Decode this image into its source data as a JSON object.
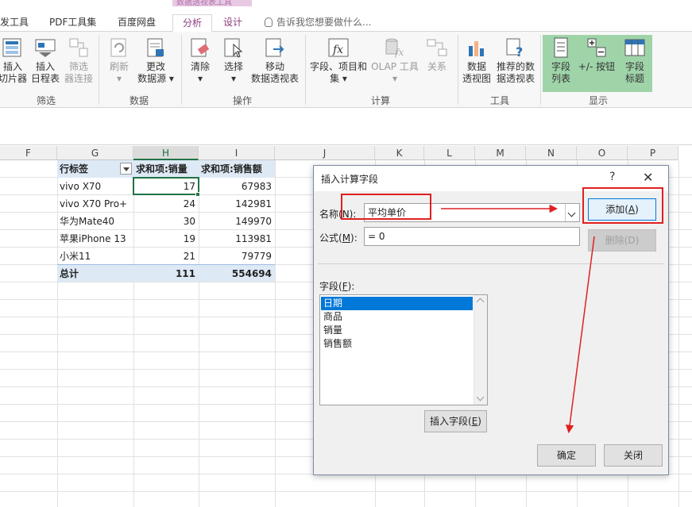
{
  "ribbon": {
    "context_tab_group": "数据透视表工具",
    "tabs": [
      {
        "label": "发工具"
      },
      {
        "label": "PDF工具集"
      },
      {
        "label": "百度网盘"
      },
      {
        "label": "分析"
      },
      {
        "label": "设计"
      }
    ],
    "tell_me": "告诉我您想要做什么...",
    "groups": [
      {
        "label": "筛选",
        "buttons": [
          {
            "l1": "插入",
            "l2": "切片器"
          },
          {
            "l1": "插入",
            "l2": "日程表"
          },
          {
            "l1": "筛选",
            "l2": "器连接"
          }
        ]
      },
      {
        "label": "数据",
        "buttons": [
          {
            "l1": "刷新",
            "l2": ""
          },
          {
            "l1": "更改",
            "l2": "数据源"
          }
        ]
      },
      {
        "label": "操作",
        "buttons": [
          {
            "l1": "清除",
            "l2": ""
          },
          {
            "l1": "选择",
            "l2": ""
          },
          {
            "l1": "移动",
            "l2": "数据透视表"
          }
        ]
      },
      {
        "label": "计算",
        "buttons": [
          {
            "l1": "字段、项目和",
            "l2": "集"
          },
          {
            "l1": "OLAP 工具",
            "l2": ""
          },
          {
            "l1": "关系",
            "l2": ""
          }
        ]
      },
      {
        "label": "工具",
        "buttons": [
          {
            "l1": "数据",
            "l2": "透视图"
          },
          {
            "l1": "推荐的数",
            "l2": "据透视表"
          }
        ]
      },
      {
        "label": "显示",
        "buttons": [
          {
            "l1": "字段",
            "l2": "列表"
          },
          {
            "l1": "+/- 按钮",
            "l2": ""
          },
          {
            "l1": "字段",
            "l2": "标题"
          }
        ]
      }
    ]
  },
  "columns": [
    "F",
    "G",
    "H",
    "I",
    "J",
    "K",
    "L",
    "M",
    "N",
    "O",
    "P"
  ],
  "pivot": {
    "headers": [
      "行标签",
      "求和项:销量",
      "求和项:销售额"
    ],
    "rows": [
      {
        "label": "vivo X70",
        "qty": "17",
        "sales": "67983"
      },
      {
        "label": "vivo X70 Pro+",
        "qty": "24",
        "sales": "142981"
      },
      {
        "label": "华为Mate40",
        "qty": "30",
        "sales": "149970"
      },
      {
        "label": "苹果iPhone 13",
        "qty": "19",
        "sales": "113981"
      },
      {
        "label": "小米11",
        "qty": "21",
        "sales": "79779"
      }
    ],
    "total": {
      "label": "总计",
      "qty": "111",
      "sales": "554694"
    }
  },
  "dialog": {
    "title": "插入计算字段",
    "help": "?",
    "close": "✕",
    "name_label": "名称(",
    "name_key": "N",
    "name_suffix": "):",
    "name_value": "平均单价",
    "formula_label": "公式(",
    "formula_key": "M",
    "formula_suffix": "):",
    "formula_value": "= 0",
    "add_button": "添加(",
    "add_key": "A",
    "add_suffix": ")",
    "delete_button": "删除(D)",
    "fields_label": "字段(",
    "fields_key": "F",
    "fields_suffix": "):",
    "fields": [
      "日期",
      "商品",
      "销量",
      "销售额"
    ],
    "insert_field_button": "插入字段(",
    "insert_field_key": "E",
    "insert_field_suffix": ")",
    "ok_button": "确定",
    "close_button": "关闭"
  },
  "colors": {
    "accent_green": "#217346",
    "annotation_red": "#e02020",
    "context_tab": "#8a3a7e",
    "pivot_header": "#dde9f5"
  }
}
